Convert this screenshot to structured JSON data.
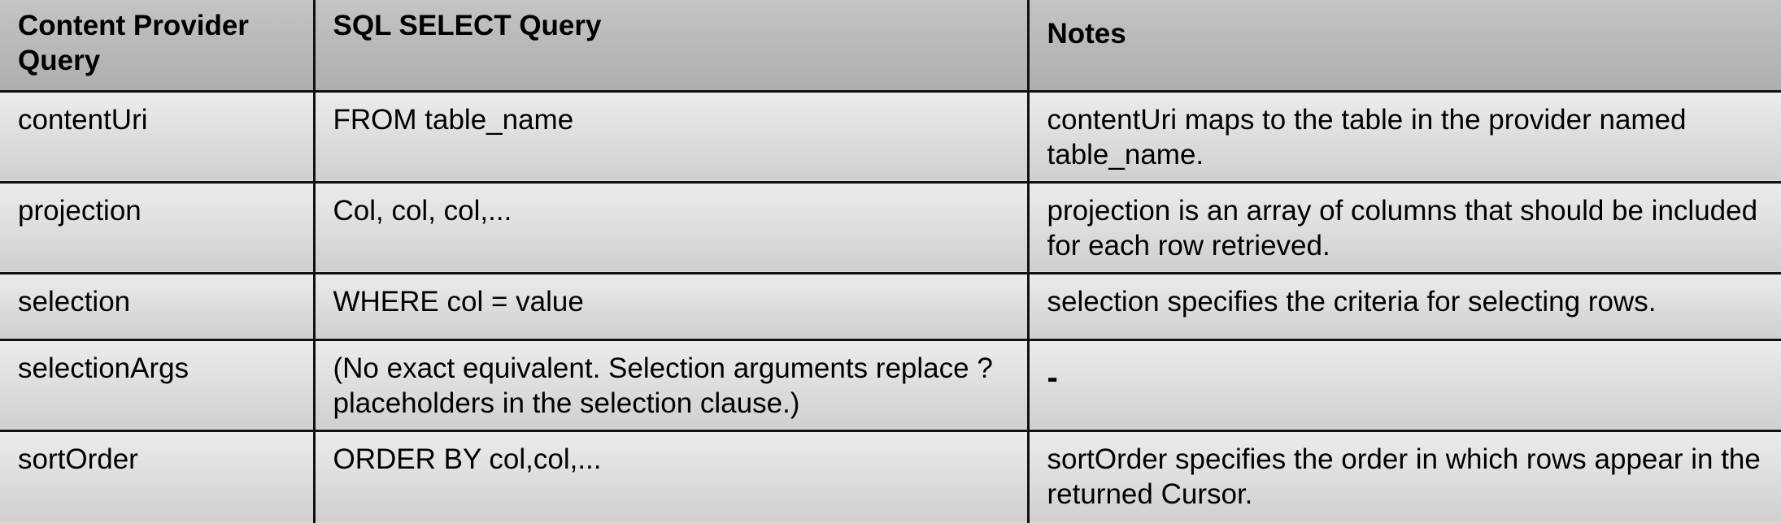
{
  "table": {
    "headers": [
      "Content Provider Query",
      "SQL SELECT Query",
      "Notes"
    ],
    "rows": [
      {
        "provider": "contentUri",
        "sql": "FROM table_name",
        "notes": "contentUri maps to the table in the provider named  table_name."
      },
      {
        "provider": "projection",
        "sql": "Col, col, col,...",
        "notes": "projection  is an array of columns that should be included for each row retrieved."
      },
      {
        "provider": "selection",
        "sql": "WHERE col = value",
        "notes": "selection  specifies the criteria for selecting rows."
      },
      {
        "provider": "selectionArgs",
        "sql": "(No exact equivalent. Selection arguments replace  ?  placeholders in the selection clause.)",
        "notes": "-"
      },
      {
        "provider": "sortOrder",
        "sql": "ORDER BY col,col,...",
        "notes": "sortOrder  specifies the order in which rows appear in the returned  Cursor."
      }
    ]
  }
}
